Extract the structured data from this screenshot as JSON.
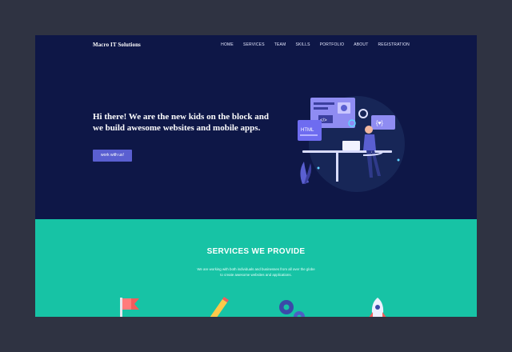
{
  "nav": {
    "brand": "Macro IT Solutions",
    "items": [
      "HOME",
      "SERVICES",
      "TEAM",
      "SKILLS",
      "PORTFOLIO",
      "ABOUT",
      "REGISTRATION"
    ]
  },
  "hero": {
    "headline": "Hi there! We are the new kids on the block and we build awesome websites and mobile apps.",
    "cta": "work with us!",
    "illustration_labels": {
      "html": "HTML",
      "code": "</>",
      "heart": "{♥}"
    }
  },
  "services": {
    "title": "SERVICES WE PROVIDE",
    "subtitle_line1": "We are working with both individuals and businesses from all over the globe",
    "subtitle_line2": "to create awesome websites and applications."
  },
  "colors": {
    "page_bg": "#2f3342",
    "hero_bg": "#0e1747",
    "accent": "#5a5fd1",
    "services_bg": "#17c3a5"
  },
  "icons": [
    "flag-icon",
    "pencil-icon",
    "gears-icon",
    "rocket-icon"
  ]
}
